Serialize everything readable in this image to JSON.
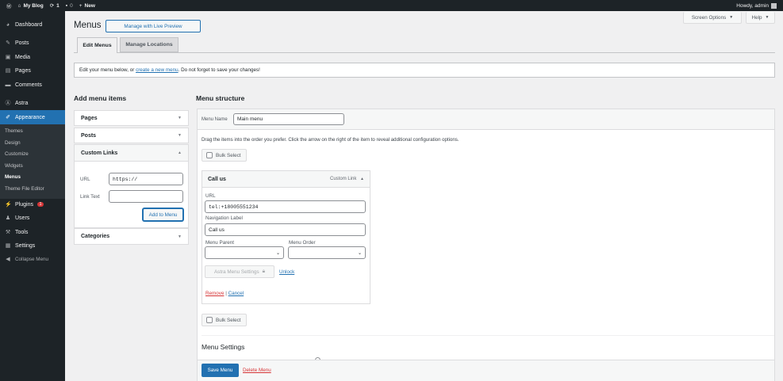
{
  "adminbar": {
    "site": "My Blog",
    "updates": "1",
    "comments": "0",
    "new": "New",
    "howdy": "Howdy, admin"
  },
  "sidebar": {
    "items": [
      {
        "label": "Dashboard",
        "icon": "dashboard-icon"
      },
      {
        "label": "Posts",
        "icon": "pin-icon"
      },
      {
        "label": "Media",
        "icon": "media-icon"
      },
      {
        "label": "Pages",
        "icon": "page-icon"
      },
      {
        "label": "Comments",
        "icon": "comment-icon"
      },
      {
        "label": "Astra",
        "icon": "astra-icon"
      },
      {
        "label": "Appearance",
        "icon": "brush-icon"
      },
      {
        "label": "Plugins",
        "icon": "plugin-icon",
        "badge": "1"
      },
      {
        "label": "Users",
        "icon": "users-icon"
      },
      {
        "label": "Tools",
        "icon": "wrench-icon"
      },
      {
        "label": "Settings",
        "icon": "settings-icon"
      },
      {
        "label": "Collapse Menu",
        "icon": "collapse-icon"
      }
    ],
    "submenu": [
      "Themes",
      "Design",
      "Customize",
      "Widgets",
      "Menus",
      "Theme File Editor"
    ]
  },
  "header": {
    "title": "Menus",
    "live_preview": "Manage with Live Preview",
    "screen_options": "Screen Options",
    "help": "Help"
  },
  "tabs": [
    "Edit Menus",
    "Manage Locations"
  ],
  "notice": {
    "before": "Edit your menu below, or ",
    "link": "create a new menu",
    "after": ". Do not forget to save your changes!"
  },
  "add_items": {
    "title": "Add menu items",
    "sections": [
      "Pages",
      "Posts",
      "Custom Links",
      "Categories"
    ],
    "url_label": "URL",
    "url_value": "https://",
    "link_text_label": "Link Text",
    "link_text_value": "",
    "add_button": "Add to Menu"
  },
  "structure": {
    "title": "Menu structure",
    "menu_name_label": "Menu Name",
    "menu_name_value": "Main menu",
    "instructions": "Drag the items into the order you prefer. Click the arrow on the right of the item to reveal additional configuration options.",
    "bulk_select": "Bulk Select",
    "item": {
      "title": "Call us",
      "type": "Custom Link",
      "url_label": "URL",
      "url_value": "tel:+18005551234",
      "nav_label": "Navigation Label",
      "nav_value": "Call us",
      "parent_label": "Menu Parent",
      "order_label": "Menu Order",
      "astra_button": "Astra Menu Settings",
      "unlock": "Unlock",
      "remove": "Remove",
      "sep": "|",
      "cancel": "Cancel"
    },
    "settings_title": "Menu Settings",
    "save": "Save Menu",
    "delete": "Delete Menu"
  },
  "colors": {
    "accent": "#2271b1",
    "sidebar": "#1d2327",
    "danger": "#d63638"
  }
}
